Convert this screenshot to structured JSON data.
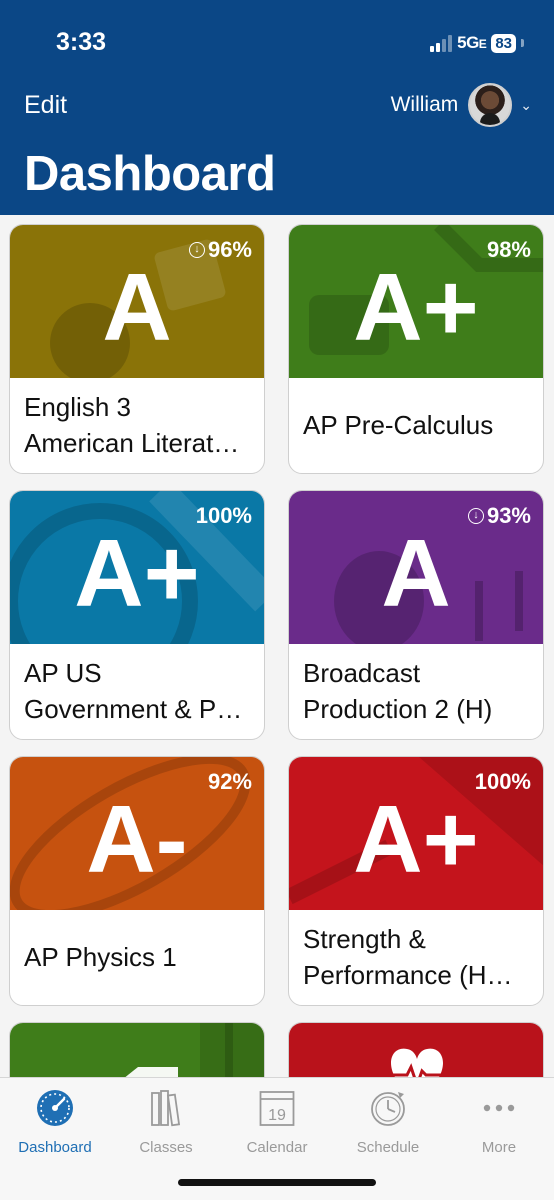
{
  "status_bar": {
    "time": "3:33",
    "network": "5G",
    "network_suffix": "E",
    "battery": "83"
  },
  "header": {
    "edit_label": "Edit",
    "user_name": "William",
    "title": "Dashboard"
  },
  "colors": {
    "header": "#0b4786",
    "accent": "#1f6fb4"
  },
  "courses": [
    {
      "grade": "A",
      "percent": "96%",
      "download": true,
      "line1": "English 3",
      "line2": "American Literat…",
      "color": "#8a7308"
    },
    {
      "grade": "A+",
      "percent": "98%",
      "download": false,
      "line1": "AP Pre-Calculus",
      "line2": "",
      "color": "#3f7d1a"
    },
    {
      "grade": "A+",
      "percent": "100%",
      "download": false,
      "line1": "AP US",
      "line2": "Government & P…",
      "color": "#0a78a6"
    },
    {
      "grade": "A",
      "percent": "93%",
      "download": true,
      "line1": "Broadcast",
      "line2": "Production 2 (H)",
      "color": "#6a2b8a"
    },
    {
      "grade": "A-",
      "percent": "92%",
      "download": false,
      "line1": "AP Physics 1",
      "line2": "",
      "color": "#c6520f"
    },
    {
      "grade": "A+",
      "percent": "100%",
      "download": false,
      "line1": "Strength &",
      "line2": "Performance (H…",
      "color": "#c4141c"
    }
  ],
  "partial_cards": [
    {
      "icon": "book-icon",
      "color": "#3f7d1a"
    },
    {
      "icon": "heart-pulse-icon",
      "color": "#b9121b"
    }
  ],
  "tabs": [
    {
      "label": "Dashboard",
      "icon": "speedometer-icon",
      "active": true
    },
    {
      "label": "Classes",
      "icon": "books-icon",
      "active": false
    },
    {
      "label": "Calendar",
      "icon": "calendar-icon",
      "active": false,
      "day": "19"
    },
    {
      "label": "Schedule",
      "icon": "clock-icon",
      "active": false
    },
    {
      "label": "More",
      "icon": "more-dots-icon",
      "active": false
    }
  ]
}
